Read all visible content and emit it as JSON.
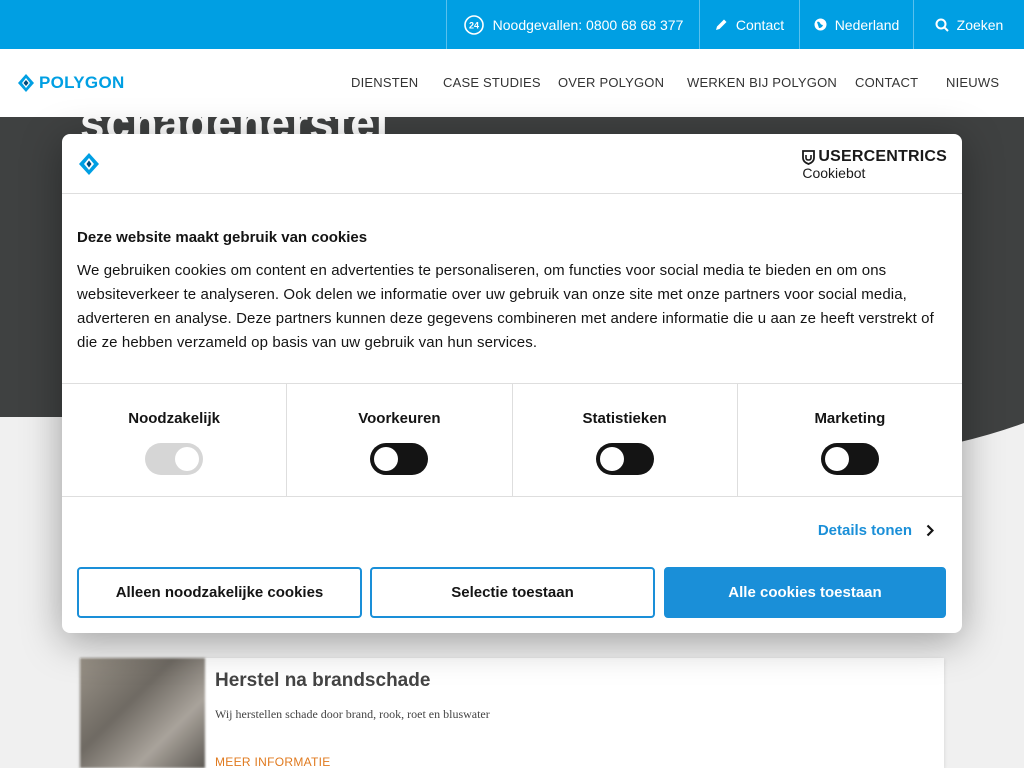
{
  "topbar": {
    "emergency_label": "Noodgevallen: 0800 68 68 377",
    "contact_label": "Contact",
    "language_label": "Nederland",
    "search_label": "Zoeken"
  },
  "brand": {
    "name": "POLYGON",
    "color": "#009fe3"
  },
  "nav": {
    "items": [
      {
        "label": "DIENSTEN"
      },
      {
        "label": "CASE STUDIES"
      },
      {
        "label": "OVER POLYGON"
      },
      {
        "label": "WERKEN BIJ POLYGON"
      },
      {
        "label": "CONTACT"
      },
      {
        "label": "NIEUWS"
      }
    ]
  },
  "hero": {
    "title": "schadeherstel"
  },
  "card": {
    "title": "Herstel na brandschade",
    "description": "Wij herstellen schade door brand, rook, roet en bluswater",
    "link": "MEER INFORMATIE"
  },
  "cookie_dialog": {
    "brand_top": "USERCENTRICS",
    "brand_sub": "Cookiebot",
    "title": "Deze website maakt gebruik van cookies",
    "text": "We gebruiken cookies om content en advertenties te personaliseren, om functies voor social media te bieden en om ons websiteverkeer te analyseren. Ook delen we informatie over uw gebruik van onze site met onze partners voor social media, adverteren en analyse. Deze partners kunnen deze gegevens combineren met andere informatie die u aan ze heeft verstrekt of die ze hebben verzameld op basis van uw gebruik van hun services.",
    "categories": [
      {
        "label": "Noodzakelijk",
        "state": "on-disabled"
      },
      {
        "label": "Voorkeuren",
        "state": "off"
      },
      {
        "label": "Statistieken",
        "state": "off"
      },
      {
        "label": "Marketing",
        "state": "off"
      }
    ],
    "details_label": "Details tonen",
    "buttons": {
      "necessary": "Alleen noodzakelijke cookies",
      "selection": "Selectie toestaan",
      "all": "Alle cookies toestaan"
    },
    "accent_color": "#1a8fd8"
  }
}
